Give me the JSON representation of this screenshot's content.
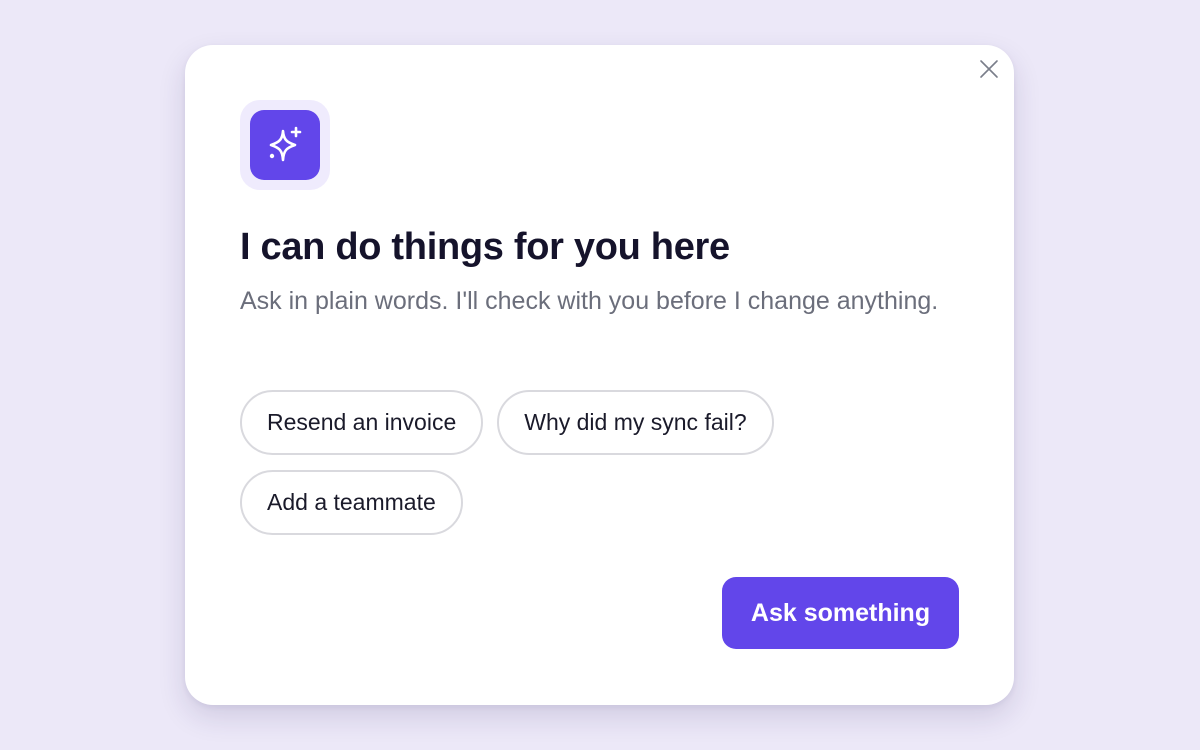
{
  "dialog": {
    "title": "I can do things for you here",
    "subtitle": "Ask in plain words. I'll check with you before I change anything.",
    "icon": "sparkles-icon",
    "close_icon": "close-icon",
    "suggestions": [
      {
        "label": "Resend an invoice"
      },
      {
        "label": "Why did my sync fail?"
      },
      {
        "label": "Add a teammate"
      }
    ],
    "primary_button_label": "Ask something"
  },
  "colors": {
    "accent": "#6246EA",
    "accent_tint": "#EFEBFD",
    "background": "#ECE8F8",
    "title": "#15132B",
    "subtitle": "#6B6E7B",
    "chip_border": "#D9D9DE"
  }
}
